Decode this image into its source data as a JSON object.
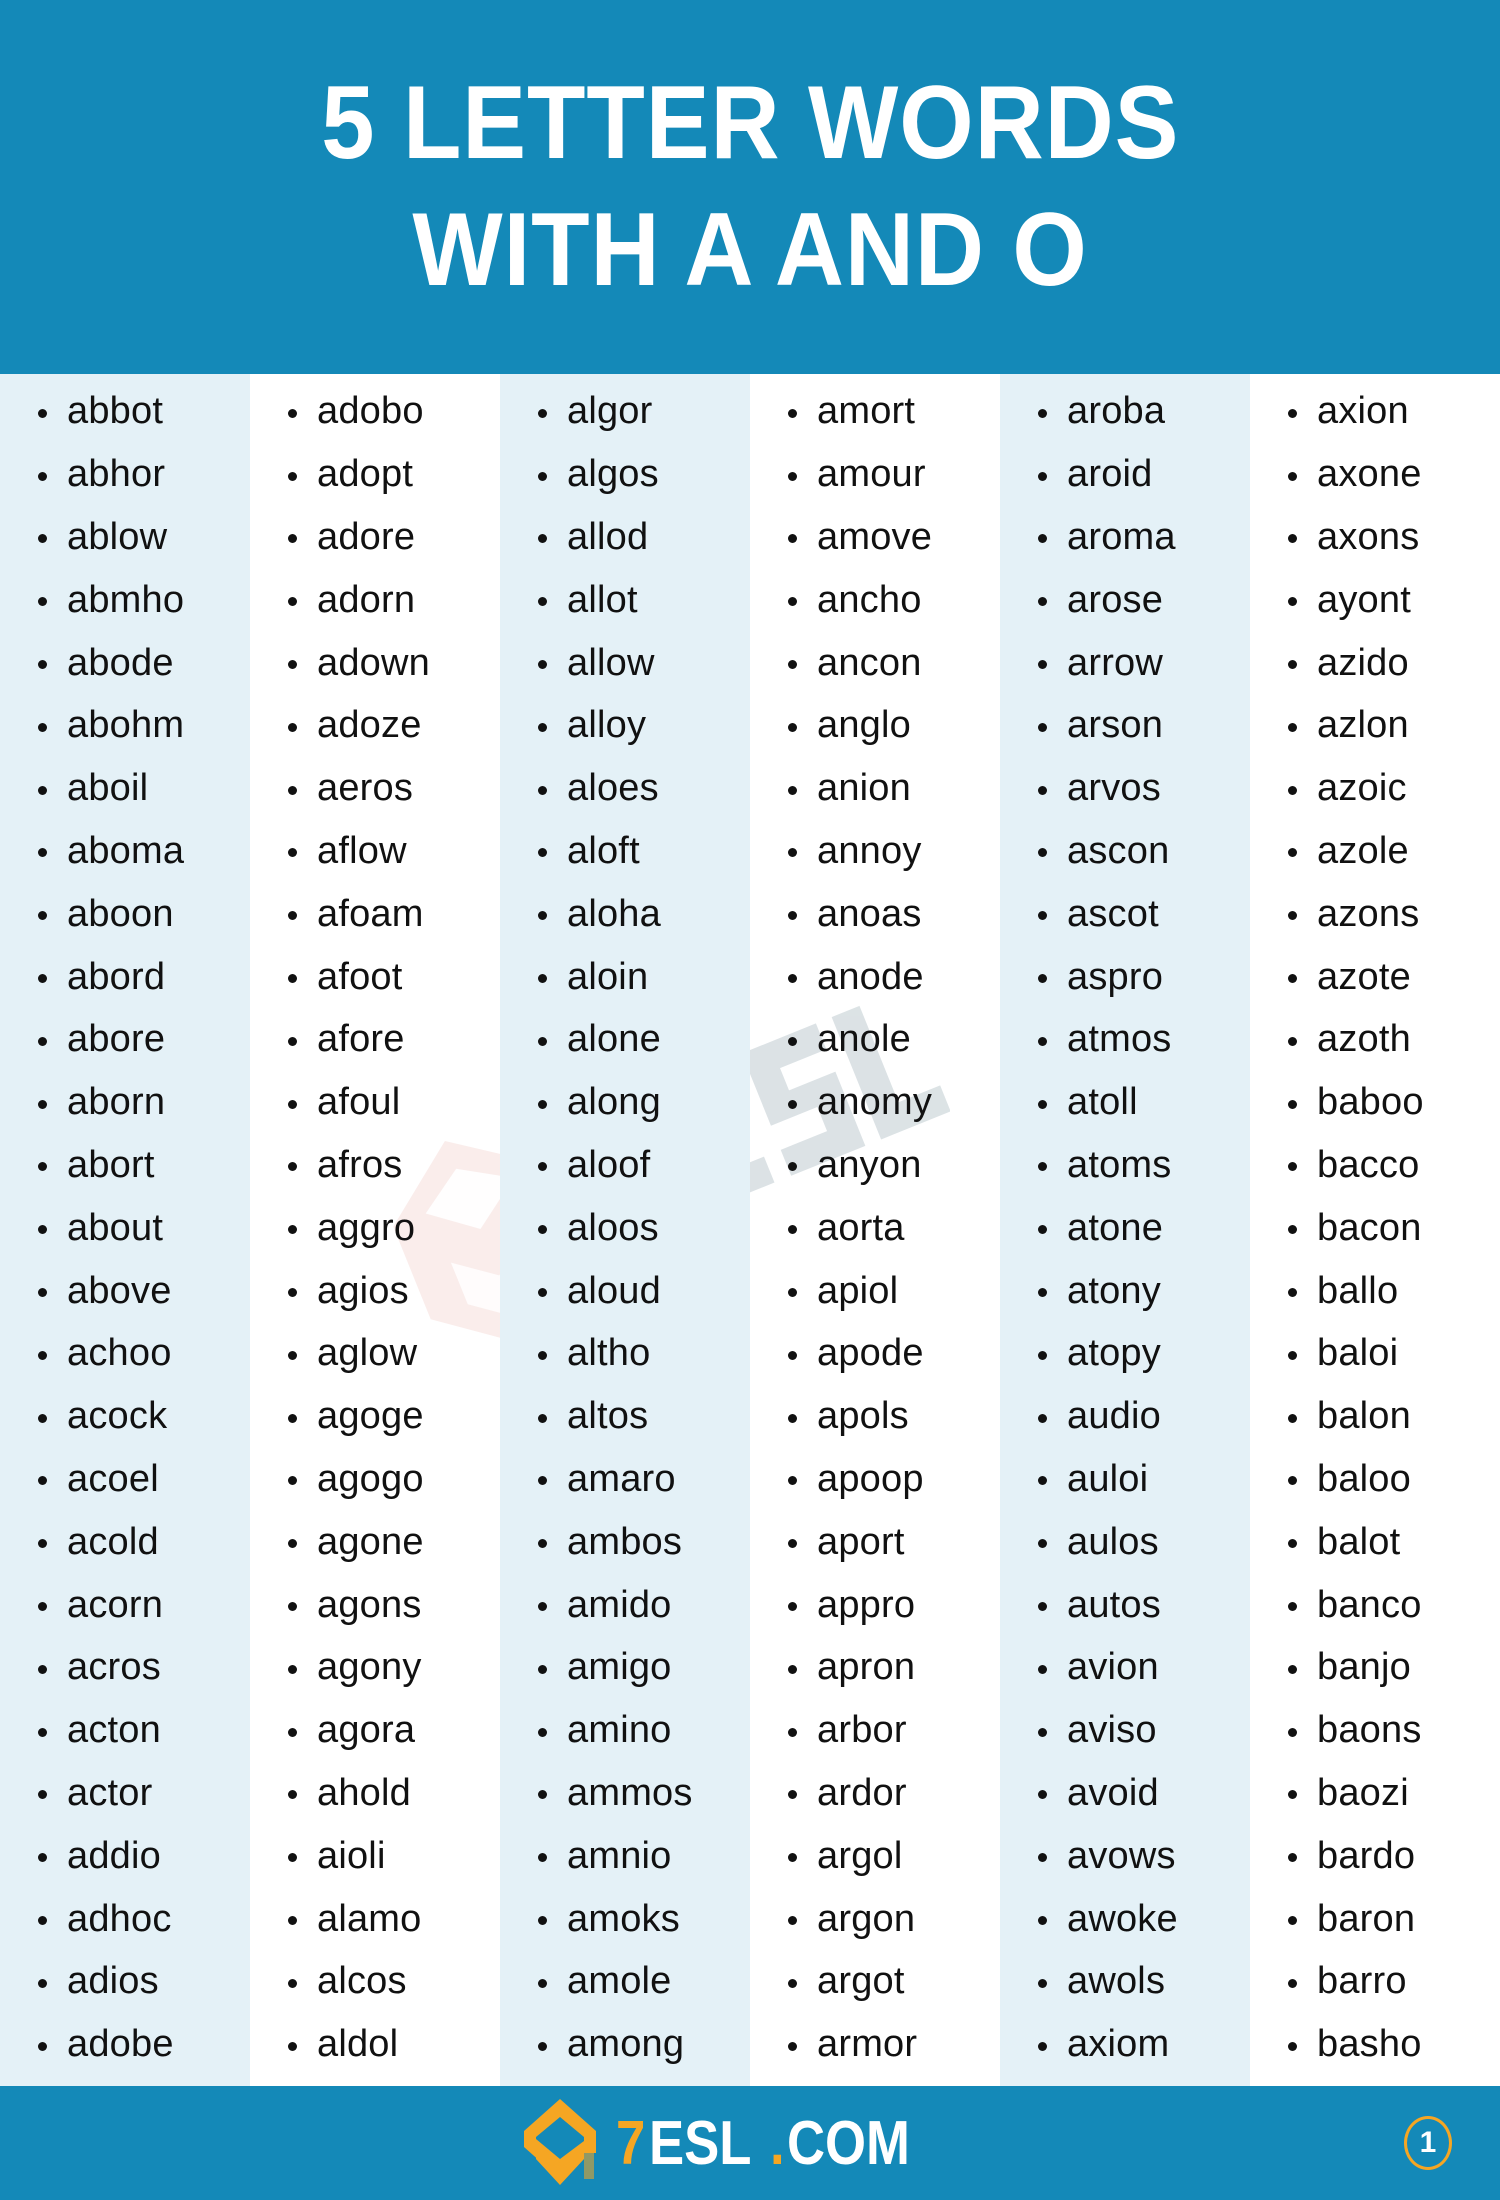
{
  "header": {
    "title_line1": "5 LETTER WORDS",
    "title_line2": "WITH A AND O",
    "bg_color": "#1489b8",
    "text_color": "#ffffff"
  },
  "watermark": {
    "text": "7ESL.COM",
    "icon": "7esl-logo-watermark"
  },
  "columns": [
    {
      "shaded": true,
      "words": [
        "abbot",
        "abhor",
        "ablow",
        "abmho",
        "abode",
        "abohm",
        "aboil",
        "aboma",
        "aboon",
        "abord",
        "abore",
        "aborn",
        "abort",
        "about",
        "above",
        "achoo",
        "acock",
        "acoel",
        "acold",
        "acorn",
        "acros",
        "acton",
        "actor",
        "addio",
        "adhoc",
        "adios",
        "adobe"
      ]
    },
    {
      "shaded": false,
      "words": [
        "adobo",
        "adopt",
        "adore",
        "adorn",
        "adown",
        "adoze",
        "aeros",
        "aflow",
        "afoam",
        "afoot",
        "afore",
        "afoul",
        "afros",
        "aggro",
        "agios",
        "aglow",
        "agoge",
        "agogo",
        "agone",
        "agons",
        "agony",
        "agora",
        "ahold",
        "aioli",
        "alamo",
        "alcos",
        "aldol"
      ]
    },
    {
      "shaded": true,
      "words": [
        "algor",
        "algos",
        "allod",
        "allot",
        "allow",
        "alloy",
        "aloes",
        "aloft",
        "aloha",
        "aloin",
        "alone",
        "along",
        "aloof",
        "aloos",
        "aloud",
        "altho",
        "altos",
        "amaro",
        "ambos",
        "amido",
        "amigo",
        "amino",
        "ammos",
        "amnio",
        "amoks",
        "amole",
        "among"
      ]
    },
    {
      "shaded": false,
      "words": [
        "amort",
        "amour",
        "amove",
        "ancho",
        "ancon",
        "anglo",
        "anion",
        "annoy",
        "anoas",
        "anode",
        "anole",
        "anomy",
        "anyon",
        "aorta",
        "apiol",
        "apode",
        "apols",
        "apoop",
        "aport",
        "appro",
        "apron",
        "arbor",
        "ardor",
        "argol",
        "argon",
        "argot",
        "armor"
      ]
    },
    {
      "shaded": true,
      "words": [
        "aroba",
        "aroid",
        "aroma",
        "arose",
        "arrow",
        "arson",
        "arvos",
        "ascon",
        "ascot",
        "aspro",
        "atmos",
        "atoll",
        "atoms",
        "atone",
        "atony",
        "atopy",
        "audio",
        "auloi",
        "aulos",
        "autos",
        "avion",
        "aviso",
        "avoid",
        "avows",
        "awoke",
        "awols",
        "axiom"
      ]
    },
    {
      "shaded": false,
      "words": [
        "axion",
        "axone",
        "axons",
        "ayont",
        "azido",
        "azlon",
        "azoic",
        "azole",
        "azons",
        "azote",
        "azoth",
        "baboo",
        "bacco",
        "bacon",
        "ballo",
        "baloi",
        "balon",
        "baloo",
        "balot",
        "banco",
        "banjo",
        "baons",
        "baozi",
        "bardo",
        "baron",
        "barro",
        "basho"
      ]
    }
  ],
  "footer": {
    "logo_seven": "7",
    "logo_esl": "ESL",
    "logo_dot": ".",
    "logo_com": "COM",
    "page_number": "1",
    "bg_color": "#1489b8",
    "accent_color": "#f5a623"
  }
}
